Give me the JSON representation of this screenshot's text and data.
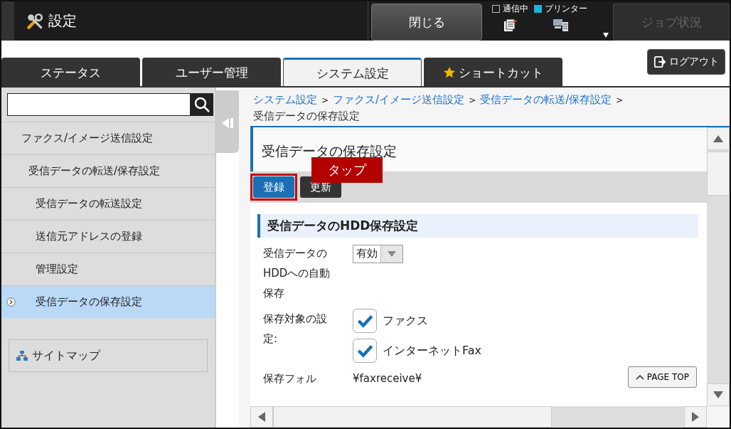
{
  "header": {
    "title": "設定",
    "close_button": "閉じる",
    "indicators": [
      {
        "label": "通信中",
        "on": false
      },
      {
        "label": "プリンター",
        "on": true
      }
    ],
    "job_button": {
      "label": "ジョブ状況",
      "disabled": true
    }
  },
  "tabs": [
    {
      "label": "ステータス",
      "selected": false,
      "kind": "plain"
    },
    {
      "label": "ユーザー管理",
      "selected": false,
      "kind": "plain"
    },
    {
      "label": "システム設定",
      "selected": true,
      "kind": "plain"
    },
    {
      "label": "ショートカット",
      "selected": false,
      "kind": "star"
    }
  ],
  "logout_button": "ログアウト",
  "sidebar": {
    "items": [
      {
        "label": "ファクス/イメージ送信設定",
        "selected": false,
        "children": [
          {
            "label": "受信データの転送/保存設定",
            "selected": false,
            "children": [
              {
                "label": "受信データの転送設定",
                "selected": false
              },
              {
                "label": "送信元アドレスの登録",
                "selected": false
              },
              {
                "label": "管理設定",
                "selected": false
              },
              {
                "label": "受信データの保存設定",
                "selected": true
              }
            ]
          }
        ]
      }
    ],
    "sitemap": "サイトマップ"
  },
  "breadcrumb": {
    "links": [
      "システム設定",
      "ファクス/イメージ送信設定",
      "受信データの転送/保存設定"
    ],
    "separator": ">",
    "current": "受信データの保存設定"
  },
  "page": {
    "title": "受信データの保存設定",
    "buttons": [
      {
        "label": "登録",
        "kind": "primary",
        "highlighted": true
      },
      {
        "label": "更新",
        "kind": "dark",
        "highlighted": false
      }
    ],
    "callout": "タップ",
    "section": "受信データのHDD保存設定",
    "rows": [
      {
        "label": "受信データのHDDへの自動保存",
        "kind": "select",
        "value": "有効"
      },
      {
        "label": "保存対象の設定:",
        "kind": "checkboxes",
        "options": [
          {
            "label": "ファクス",
            "checked": true
          },
          {
            "label": "インターネットFax",
            "checked": true
          }
        ]
      },
      {
        "label": "保存フォル",
        "kind": "text",
        "value": "¥faxreceive¥"
      }
    ],
    "page_top": "PAGE TOP"
  }
}
